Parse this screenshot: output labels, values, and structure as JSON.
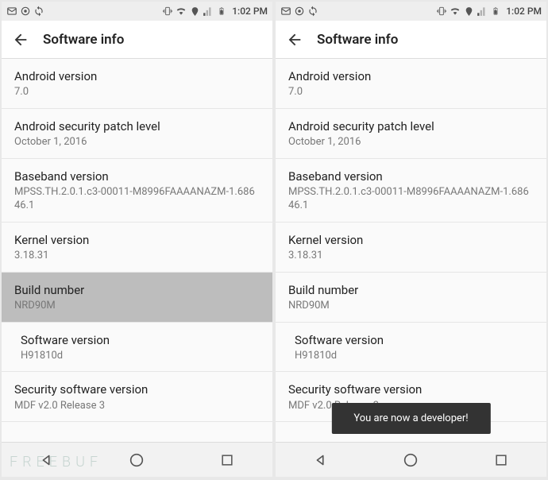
{
  "status": {
    "time": "1:02 PM"
  },
  "screens": [
    {
      "title": "Software info",
      "items": [
        {
          "title": "Android version",
          "value": "7.0",
          "pressed": false,
          "indented": false
        },
        {
          "title": "Android security patch level",
          "value": "October 1, 2016",
          "pressed": false,
          "indented": false
        },
        {
          "title": "Baseband version",
          "value": "MPSS.TH.2.0.1.c3-00011-M8996FAAAANAZM-1.68646.1",
          "pressed": false,
          "indented": false
        },
        {
          "title": "Kernel version",
          "value": "3.18.31",
          "pressed": false,
          "indented": false
        },
        {
          "title": "Build number",
          "value": "NRD90M",
          "pressed": true,
          "indented": false
        },
        {
          "title": "Software version",
          "value": "H91810d",
          "pressed": false,
          "indented": true
        },
        {
          "title": "Security software version",
          "value": "MDF v2.0 Release 3",
          "pressed": false,
          "indented": false
        }
      ],
      "toast": null,
      "watermark": "FREEBUF"
    },
    {
      "title": "Software info",
      "items": [
        {
          "title": "Android version",
          "value": "7.0",
          "pressed": false,
          "indented": false
        },
        {
          "title": "Android security patch level",
          "value": "October 1, 2016",
          "pressed": false,
          "indented": false
        },
        {
          "title": "Baseband version",
          "value": "MPSS.TH.2.0.1.c3-00011-M8996FAAAANAZM-1.68646.1",
          "pressed": false,
          "indented": false
        },
        {
          "title": "Kernel version",
          "value": "3.18.31",
          "pressed": false,
          "indented": false
        },
        {
          "title": "Build number",
          "value": "NRD90M",
          "pressed": false,
          "indented": false
        },
        {
          "title": "Software version",
          "value": "H91810d",
          "pressed": false,
          "indented": true
        },
        {
          "title": "Security software version",
          "value": "MDF v2.0 Release 3",
          "pressed": false,
          "indented": false
        }
      ],
      "toast": "You are now a developer!",
      "watermark": null
    }
  ]
}
